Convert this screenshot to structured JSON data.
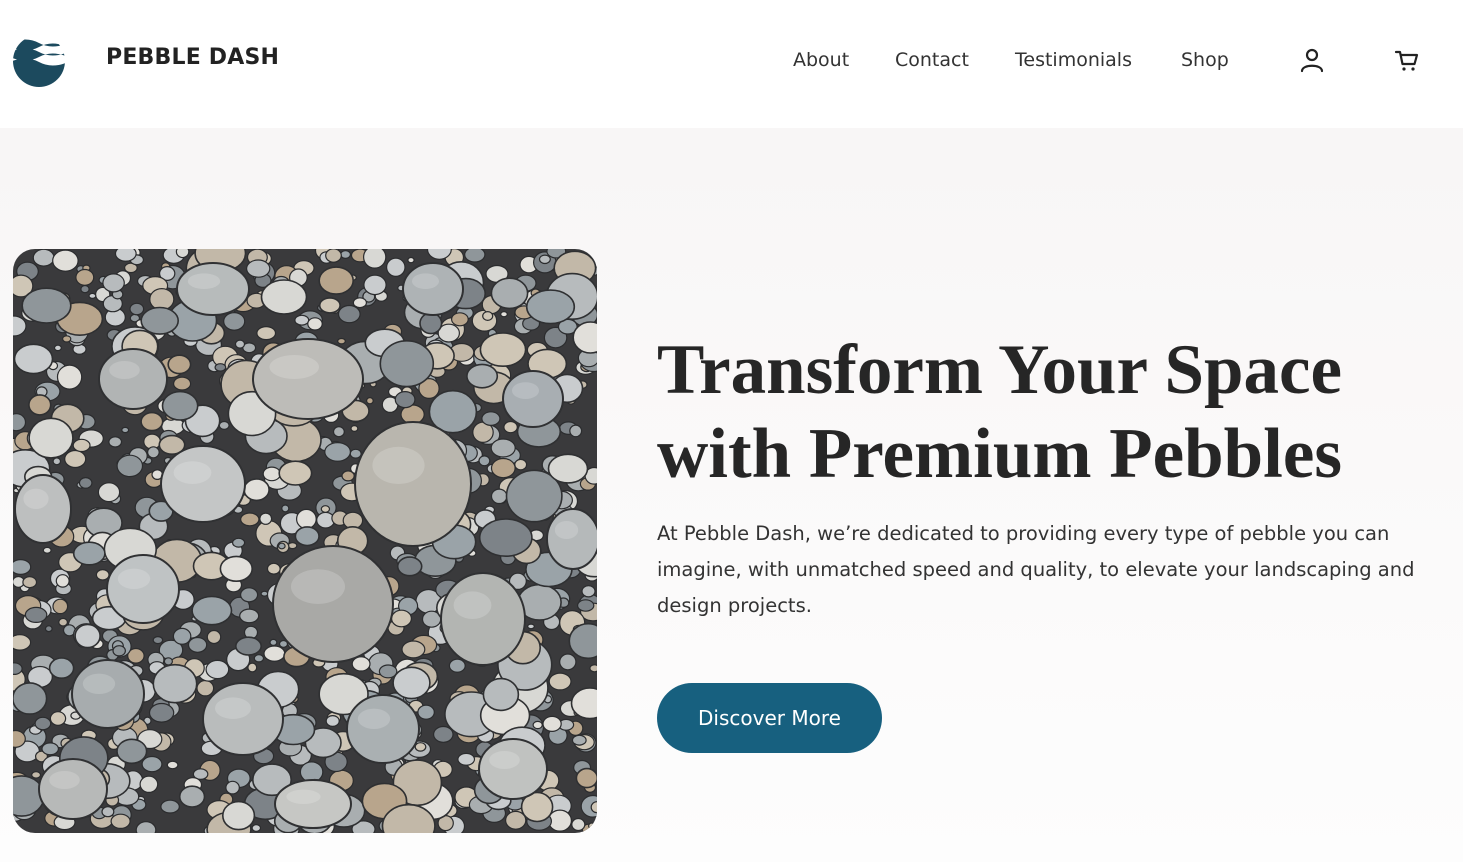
{
  "header": {
    "brand": "PEBBLE DASH",
    "logo_icon": "wave-logo-icon",
    "nav": [
      {
        "label": "About"
      },
      {
        "label": "Contact"
      },
      {
        "label": "Testimonials"
      },
      {
        "label": "Shop"
      }
    ],
    "account_icon": "user-icon",
    "cart_icon": "cart-icon"
  },
  "hero": {
    "image_subject": "pebbles-photo",
    "headline_line1": "Transform Your Space",
    "headline_line2": "with Premium Pebbles",
    "description": "At Pebble Dash, we’re dedicated to providing every type of pebble you can imagine, with unmatched speed and quality, to elevate your landscaping and design projects.",
    "cta_label": "Discover More"
  },
  "colors": {
    "accent": "#17607f",
    "logo": "#1c4a5e",
    "text": "#262626",
    "hero_background": "#f8f6f6"
  }
}
